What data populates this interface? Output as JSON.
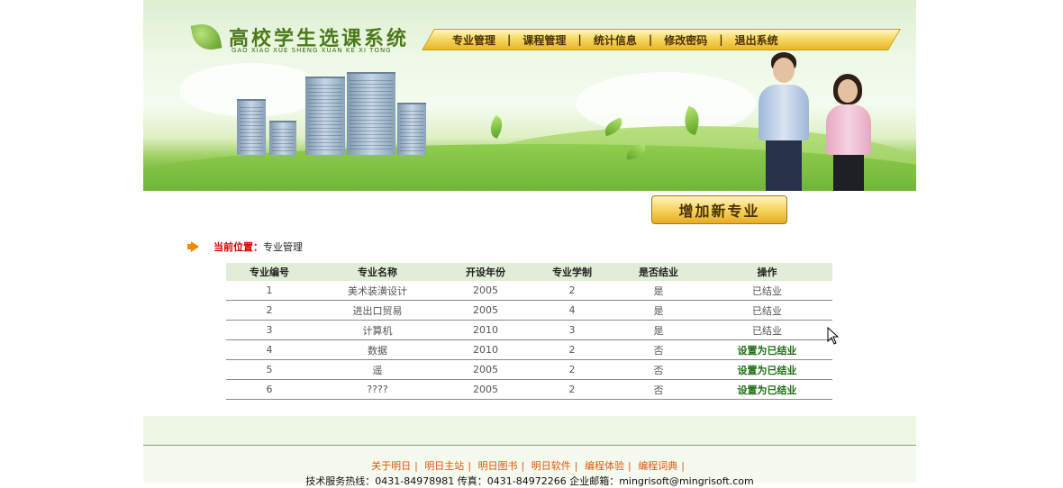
{
  "logo": {
    "title": "高校学生选课系统",
    "subtitle": "GAO XIAO XUE SHENG XUAN KE XI TONG"
  },
  "nav": {
    "items": [
      "专业管理",
      "课程管理",
      "统计信息",
      "修改密码",
      "退出系统"
    ],
    "separator": "|"
  },
  "add_button": {
    "label": "增加新专业"
  },
  "breadcrumb": {
    "label": "当前位置：",
    "value": "专业管理"
  },
  "table": {
    "headers": [
      "专业编号",
      "专业名称",
      "开设年份",
      "专业学制",
      "是否结业",
      "操作"
    ],
    "rows": [
      [
        "1",
        "美术装潢设计",
        "2005",
        "2",
        "是",
        "已结业"
      ],
      [
        "2",
        "进出口贸易",
        "2005",
        "4",
        "是",
        "已结业"
      ],
      [
        "3",
        "计算机",
        "2010",
        "3",
        "是",
        "已结业"
      ],
      [
        "4",
        "数据",
        "2010",
        "2",
        "否",
        "设置为已结业"
      ],
      [
        "5",
        "遥",
        "2005",
        "2",
        "否",
        "设置为已结业"
      ],
      [
        "6",
        "????",
        "2005",
        "2",
        "否",
        "设置为已结业"
      ]
    ]
  },
  "footer": {
    "links": [
      "关于明日",
      "明日主站",
      "明日图书",
      "明日软件",
      "编程体验",
      "编程词典"
    ],
    "separator": "|",
    "contact": "技术服务热线：0431-84978981 传真：0431-84972266 企业邮箱：mingrisoft@mingrisoft.com"
  },
  "colors": {
    "nav_gold": "#f8d964",
    "link_green": "#1f6f15",
    "crumb_red": "#d40000",
    "footer_orange": "#e0570a"
  }
}
